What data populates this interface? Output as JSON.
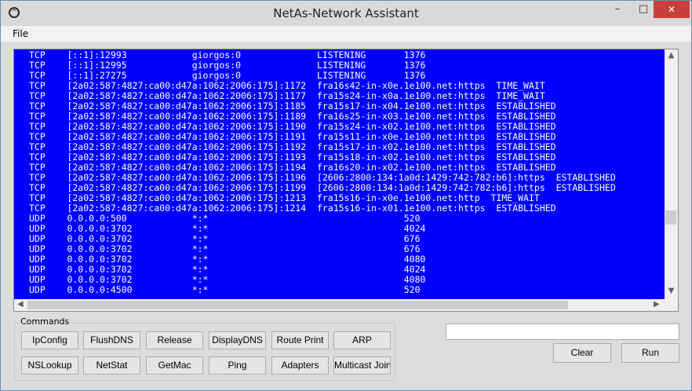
{
  "window": {
    "title": "NetAs-Network Assistant",
    "minimize_glyph": "–",
    "maximize_glyph": "□",
    "close_glyph": "✕"
  },
  "menu": {
    "file": "File"
  },
  "console": {
    "background": "#0000ff",
    "text_color": "#ffffff",
    "lines": [
      "TCP    [::1]:12993            giorgos:0              LISTENING       1376",
      "TCP    [::1]:12995            giorgos:0              LISTENING       1376",
      "TCP    [::1]:27275            giorgos:0              LISTENING       1376",
      "TCP    [2a02:587:4827:ca00:d47a:1062:2006:175]:1172  fra16s42-in-x0e.1e100.net:https  TIME_WAIT",
      "TCP    [2a02:587:4827:ca00:d47a:1062:2006:175]:1177  fra15s24-in-x0a.1e100.net:https  TIME_WAIT",
      "TCP    [2a02:587:4827:ca00:d47a:1062:2006:175]:1185  fra15s17-in-x04.1e100.net:https  ESTABLISHED",
      "TCP    [2a02:587:4827:ca00:d47a:1062:2006:175]:1189  fra16s25-in-x03.1e100.net:https  ESTABLISHED",
      "TCP    [2a02:587:4827:ca00:d47a:1062:2006:175]:1190  fra15s24-in-x02.1e100.net:https  ESTABLISHED",
      "TCP    [2a02:587:4827:ca00:d47a:1062:2006:175]:1191  fra15s11-in-x0e.1e100.net:https  ESTABLISHED",
      "TCP    [2a02:587:4827:ca00:d47a:1062:2006:175]:1192  fra15s17-in-x02.1e100.net:https  ESTABLISHED",
      "TCP    [2a02:587:4827:ca00:d47a:1062:2006:175]:1193  fra15s18-in-x02.1e100.net:https  ESTABLISHED",
      "TCP    [2a02:587:4827:ca00:d47a:1062:2006:175]:1194  fra16s20-in-x02.1e100.net:https  ESTABLISHED",
      "TCP    [2a02:587:4827:ca00:d47a:1062:2006:175]:1196  [2606:2800:134:1a0d:1429:742:782:b6]:https  ESTABLISHED",
      "TCP    [2a02:587:4827:ca00:d47a:1062:2006:175]:1199  [2606:2800:134:1a0d:1429:742:782:b6]:https  ESTABLISHED",
      "TCP    [2a02:587:4827:ca00:d47a:1062:2006:175]:1213  fra15s16-in-x0e.1e100.net:http  TIME_WAIT",
      "TCP    [2a02:587:4827:ca00:d47a:1062:2006:175]:1214  fra15s16-in-x01.1e100.net:https  ESTABLISHED",
      "UDP    0.0.0.0:500            *:*                                    520",
      "UDP    0.0.0.0:3702           *:*                                    4024",
      "UDP    0.0.0.0:3702           *:*                                    676",
      "UDP    0.0.0.0:3702           *:*                                    676",
      "UDP    0.0.0.0:3702           *:*                                    4080",
      "UDP    0.0.0.0:3702           *:*                                    4024",
      "UDP    0.0.0.0:3702           *:*                                    4080",
      "UDP    0.0.0.0:4500           *:*                                    520"
    ]
  },
  "commands": {
    "group_label": "Commands",
    "buttons": [
      "IpConfig",
      "FlushDNS",
      "Release",
      "DisplayDNS",
      "Route Print",
      "ARP",
      "NSLookup",
      "NetStat",
      "GetMac",
      "Ping",
      "Adapters",
      "Multicast Joins"
    ]
  },
  "command_input": {
    "value": ""
  },
  "actions": {
    "clear": "Clear",
    "run": "Run"
  },
  "colors": {
    "close_button": "#c7413b",
    "window_bg": "#dcdcdc"
  }
}
